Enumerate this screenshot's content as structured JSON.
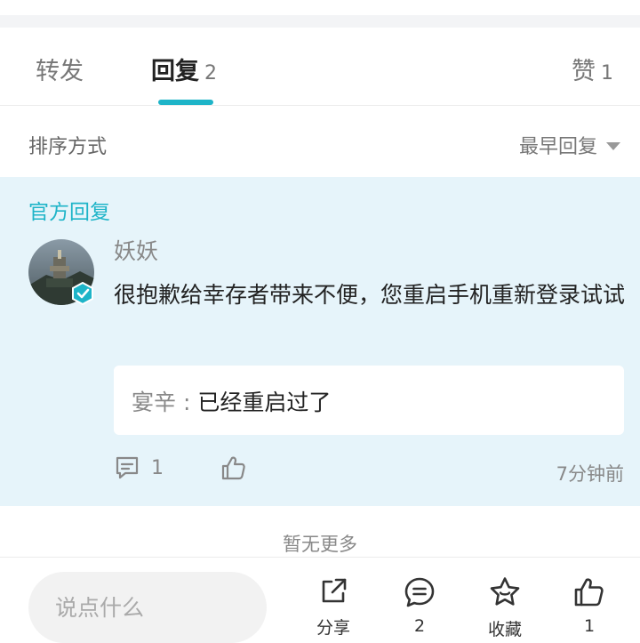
{
  "tabs": {
    "forward_label": "转发",
    "reply_label": "回复",
    "reply_count": "2",
    "like_label": "赞",
    "like_count": "1"
  },
  "sort": {
    "label": "排序方式",
    "selected": "最早回复"
  },
  "official_reply": {
    "tag": "官方回复",
    "username": "妖妖",
    "content": "很抱歉给幸存者带来不便，您重启手机重新登录试试",
    "sub_reply": {
      "name": "宴辛",
      "separator": " : ",
      "text": "已经重启过了"
    },
    "comment_count": "1",
    "time_ago": "7分钟前"
  },
  "no_more": "暂无更多",
  "bottom_bar": {
    "input_placeholder": "说点什么",
    "share_label": "分享",
    "comments_count": "2",
    "favorite_label": "收藏",
    "like_count": "1"
  },
  "colors": {
    "accent": "#1eb4c8",
    "official_bg": "#e6f4fa"
  }
}
